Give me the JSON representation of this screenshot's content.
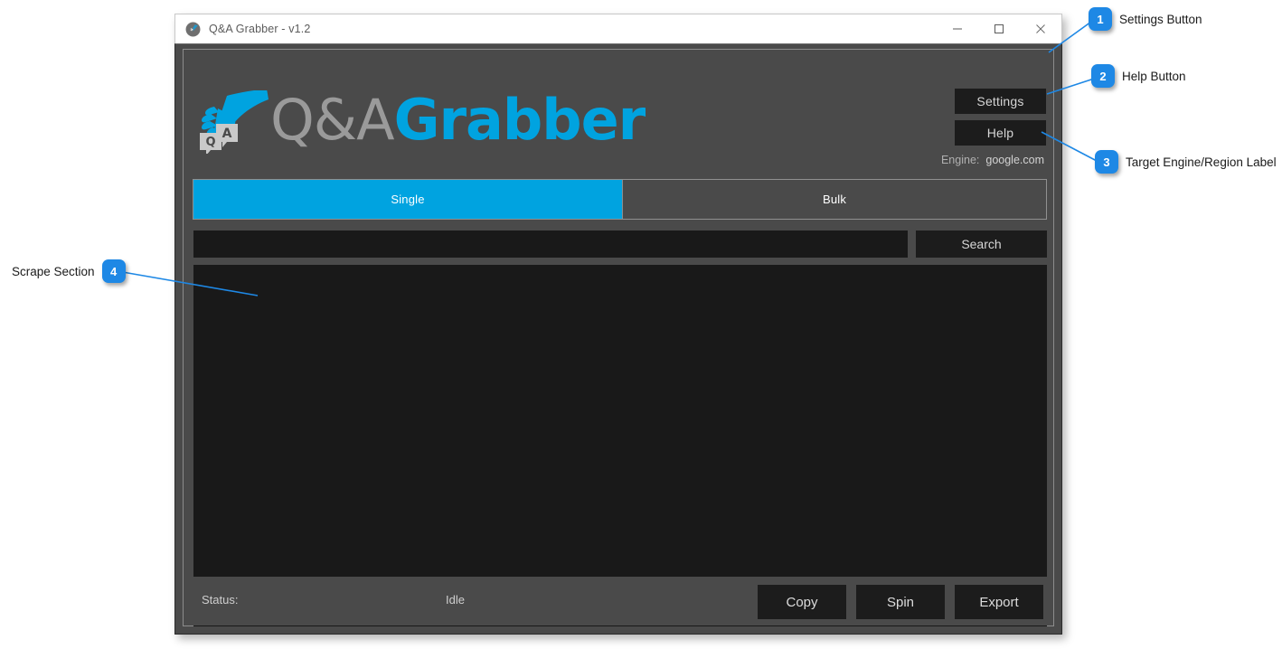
{
  "window": {
    "title": "Q&A Grabber - v1.2",
    "icon": "app-logo-icon",
    "controls": {
      "minimize": "minimize-icon",
      "maximize": "maximize-icon",
      "close": "close-icon"
    }
  },
  "header": {
    "logo_text_primary": "Q&A",
    "logo_text_accent": "Grabber",
    "settings_label": "Settings",
    "help_label": "Help",
    "engine_key": "Engine:",
    "engine_value": "google.com"
  },
  "tabs": [
    {
      "label": "Single",
      "active": true
    },
    {
      "label": "Bulk",
      "active": false
    }
  ],
  "search": {
    "value": "",
    "placeholder": "",
    "button_label": "Search"
  },
  "results": {
    "value": "",
    "placeholder": ""
  },
  "status": {
    "key": "Status:",
    "value": "Idle"
  },
  "actions": [
    {
      "label": "Copy"
    },
    {
      "label": "Spin"
    },
    {
      "label": "Export"
    }
  ],
  "callouts": [
    {
      "number": "1",
      "label": "Settings Button"
    },
    {
      "number": "2",
      "label": "Help Button"
    },
    {
      "number": "3",
      "label": "Target Engine/Region Label"
    },
    {
      "number": "4",
      "label": "Scrape Section"
    }
  ],
  "colors": {
    "accent": "#00a3e0",
    "window_chrome": "#4a4a4a",
    "field_dark": "#191919",
    "button_dark": "#1c1c1c",
    "callout_blue": "#1e88e5"
  }
}
